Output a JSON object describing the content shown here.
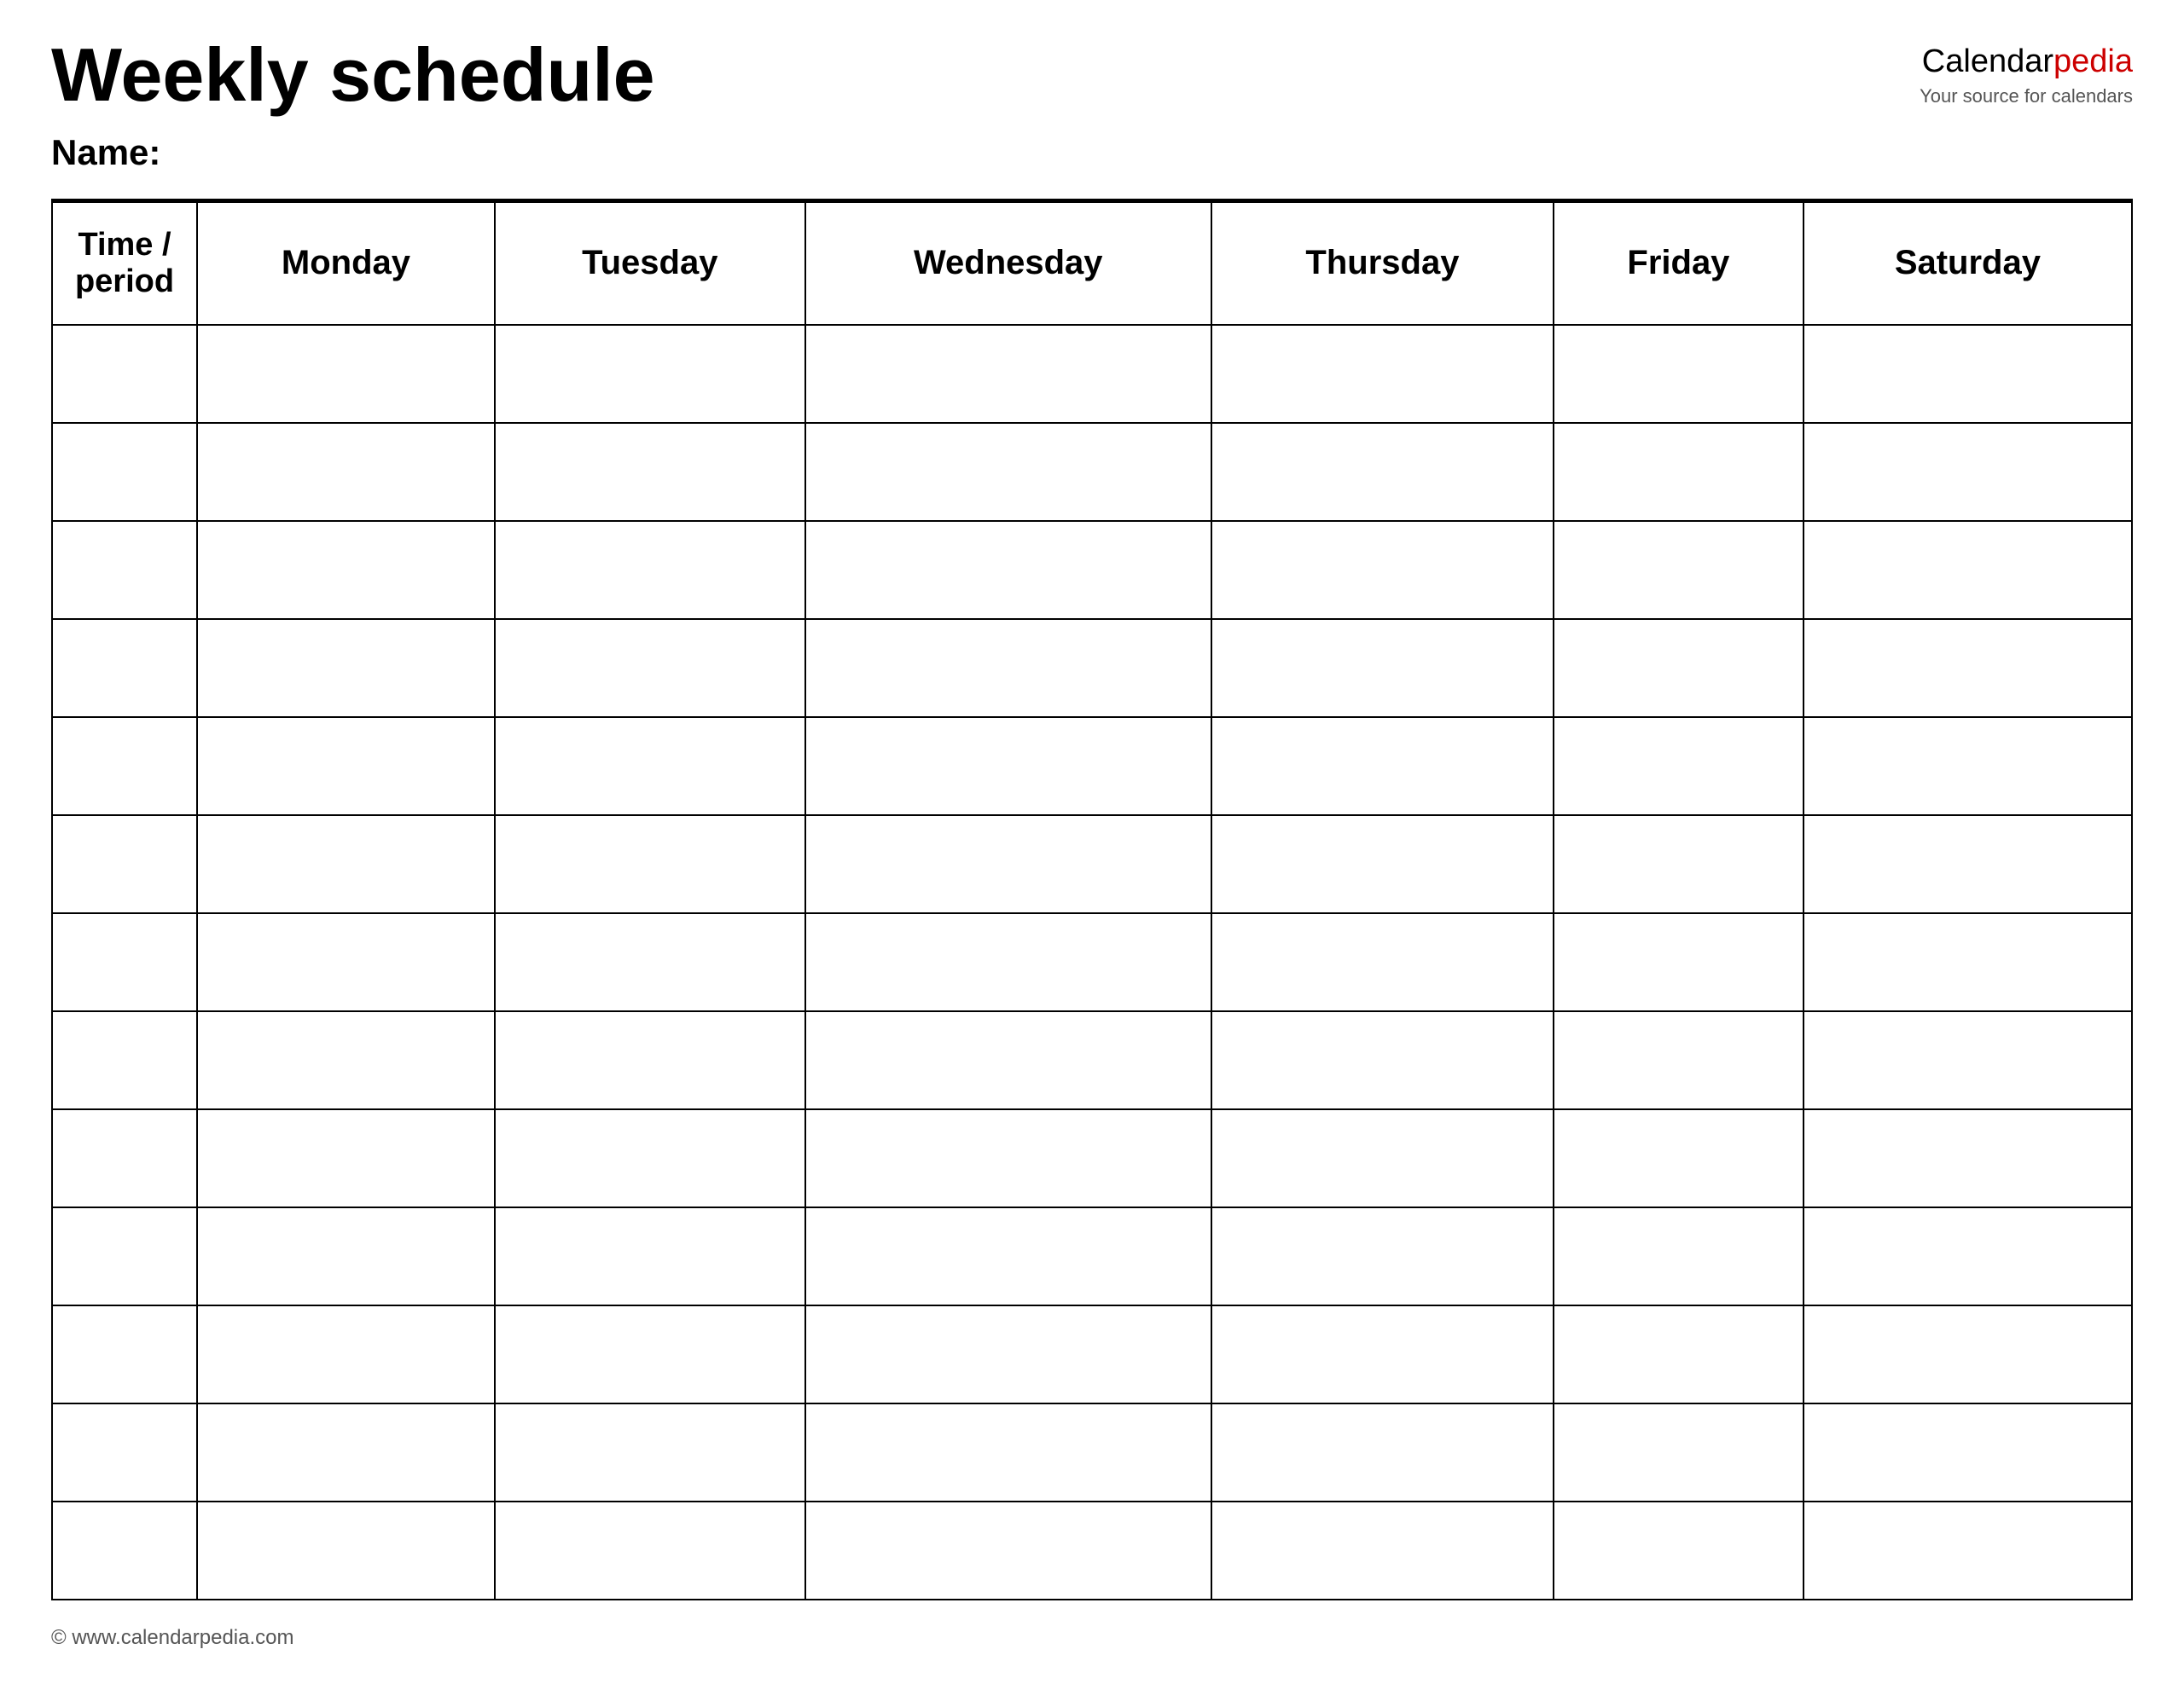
{
  "header": {
    "title": "Weekly schedule",
    "name_label": "Name:",
    "logo": {
      "calendar": "Calendar",
      "pedia": "pedia",
      "subtitle": "Your source for calendars"
    }
  },
  "table": {
    "columns": [
      {
        "key": "time",
        "label": "Time / period"
      },
      {
        "key": "monday",
        "label": "Monday"
      },
      {
        "key": "tuesday",
        "label": "Tuesday"
      },
      {
        "key": "wednesday",
        "label": "Wednesday"
      },
      {
        "key": "thursday",
        "label": "Thursday"
      },
      {
        "key": "friday",
        "label": "Friday"
      },
      {
        "key": "saturday",
        "label": "Saturday"
      }
    ],
    "row_count": 13
  },
  "footer": {
    "url": "© www.calendarpedia.com"
  }
}
